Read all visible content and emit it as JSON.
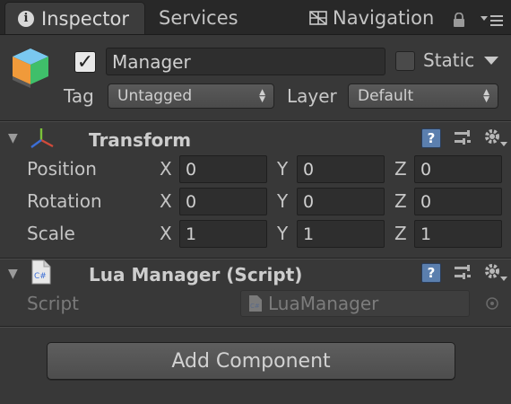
{
  "tabs": {
    "inspector": "Inspector",
    "services": "Services",
    "navigation": "Navigation"
  },
  "header": {
    "object_name": "Manager",
    "active_checked": true,
    "static_label": "Static",
    "static_checked": false,
    "tag_label": "Tag",
    "tag_value": "Untagged",
    "layer_label": "Layer",
    "layer_value": "Default"
  },
  "transform": {
    "title": "Transform",
    "rows": [
      {
        "label": "Position",
        "x": "0",
        "y": "0",
        "z": "0"
      },
      {
        "label": "Rotation",
        "x": "0",
        "y": "0",
        "z": "0"
      },
      {
        "label": "Scale",
        "x": "1",
        "y": "1",
        "z": "1"
      }
    ],
    "axis_x": "X",
    "axis_y": "Y",
    "axis_z": "Z"
  },
  "lua_manager": {
    "title": "Lua Manager (Script)",
    "script_label": "Script",
    "script_value": "LuaManager",
    "cs_badge": "C#"
  },
  "add_component_label": "Add Component",
  "colors": {
    "background": "#383838",
    "tabbar": "#282828",
    "help_icon": "#5b7fae",
    "transform_red": "#d04a3a",
    "transform_green": "#7cc23a",
    "transform_blue": "#3c6ed6"
  },
  "icons": {
    "inspector_tab": "info-icon",
    "navigation_tab": "navmesh-icon",
    "lock": "lock-icon",
    "menu": "tab-menu-icon",
    "object": "cube-icon",
    "transform": "transform-axes-icon",
    "script": "cs-script-icon",
    "help": "help-icon",
    "preset": "preset-icon",
    "settings": "gear-icon"
  }
}
